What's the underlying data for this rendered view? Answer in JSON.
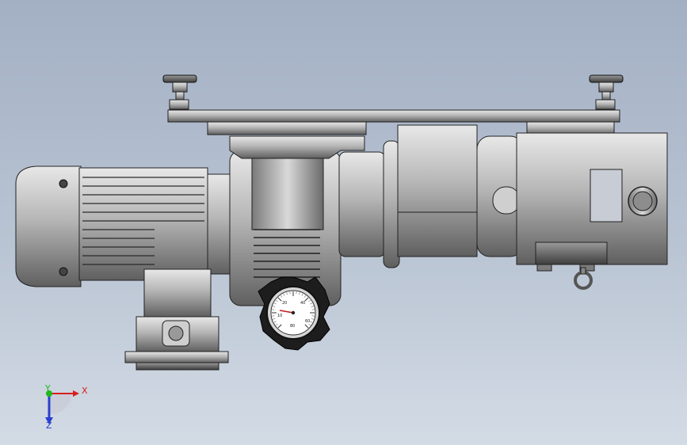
{
  "view": {
    "background_top": "#a3b0c4",
    "background_bottom": "#d3dbe5"
  },
  "triad": {
    "x_label": "X",
    "y_label": "Y",
    "z_label": "Z",
    "x_color": "#d81e1e",
    "y_color": "#1fb81f",
    "z_color": "#2a3fd0"
  },
  "gauge": {
    "scale_labels": [
      "20",
      "40",
      "60",
      "80",
      "10"
    ],
    "needle_color": "#c61a1a"
  }
}
